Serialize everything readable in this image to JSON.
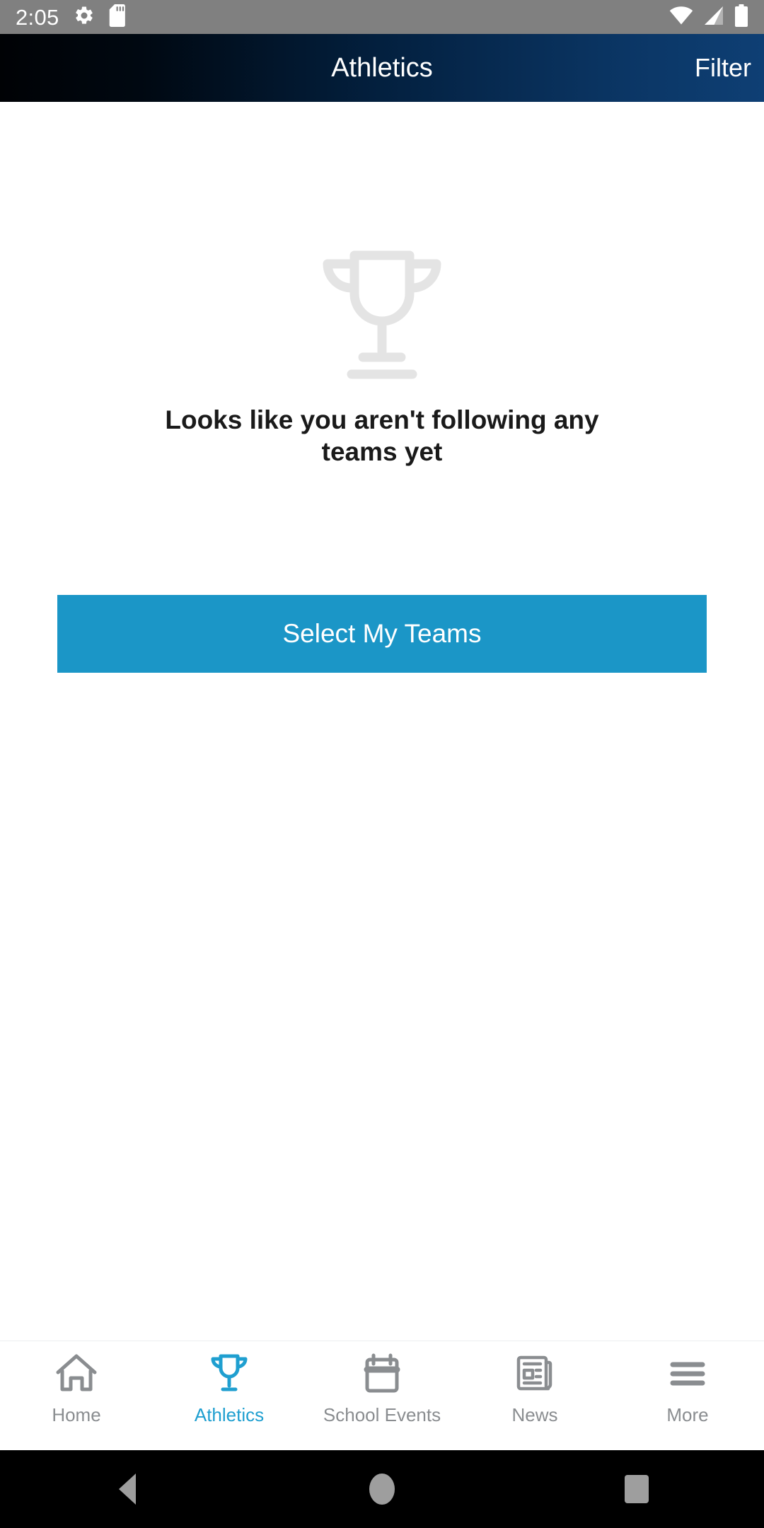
{
  "status_bar": {
    "time": "2:05",
    "left_icons": [
      "gear-icon",
      "sd-card-icon"
    ],
    "right_icons": [
      "wifi-icon",
      "cell-signal-icon",
      "battery-icon"
    ],
    "background_color": "#808080",
    "foreground_color": "#ffffff"
  },
  "header": {
    "title": "Athletics",
    "filter_label": "Filter",
    "gradient_from": "#000205",
    "gradient_to": "#0e3f74",
    "text_color": "#ffffff"
  },
  "main": {
    "illustration": "trophy-icon",
    "illustration_color": "#e4e4e4",
    "empty_message": "Looks like you aren't following any teams yet",
    "primary_action": {
      "label": "Select My Teams",
      "background_color": "#1b96c7",
      "text_color": "#ffffff"
    }
  },
  "bottom_nav": {
    "active_color": "#1f9fd0",
    "inactive_color": "#8a8d90",
    "items": [
      {
        "label": "Home",
        "icon": "house-icon",
        "active": false
      },
      {
        "label": "Athletics",
        "icon": "trophy-icon",
        "active": true
      },
      {
        "label": "School Events",
        "icon": "calendar-icon",
        "active": false
      },
      {
        "label": "News",
        "icon": "newspaper-icon",
        "active": false
      },
      {
        "label": "More",
        "icon": "hamburger-icon",
        "active": false
      }
    ]
  },
  "system_nav": {
    "background_color": "#000000",
    "icon_color": "#9e9e9e",
    "buttons": [
      "back-button",
      "home-button",
      "recents-button"
    ]
  }
}
